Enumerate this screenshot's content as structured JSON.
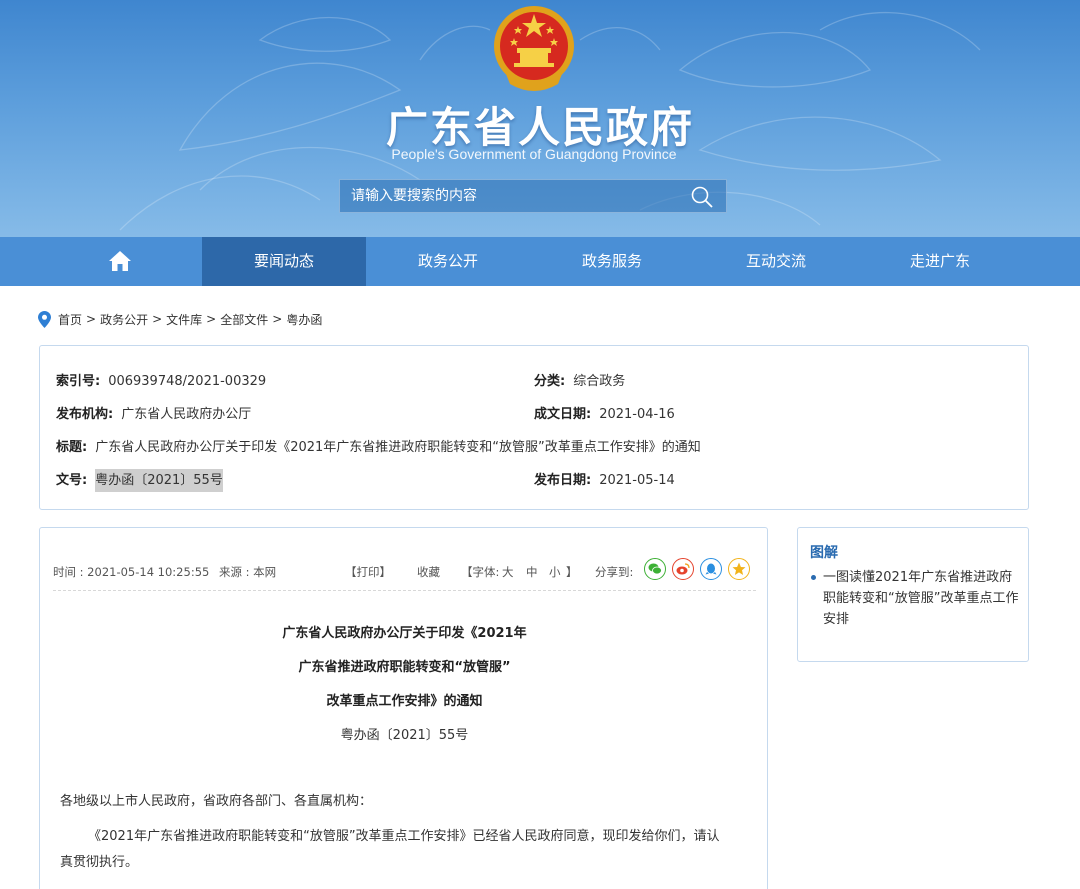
{
  "header": {
    "title": "广东省人民政府",
    "subtitle": "People's Government of Guangdong Province",
    "search_placeholder": "请输入要搜索的内容"
  },
  "nav": {
    "items": [
      "要闻动态",
      "政务公开",
      "政务服务",
      "互动交流",
      "走进广东"
    ],
    "active": "要闻动态"
  },
  "breadcrumb": [
    "首页",
    "政务公开",
    "文件库",
    "全部文件",
    "粤办函"
  ],
  "meta": {
    "index_label": "索引号:",
    "index_value": "006939748/2021-00329",
    "category_label": "分类:",
    "category_value": "综合政务",
    "publisher_label": "发布机构:",
    "publisher_value": "广东省人民政府办公厅",
    "created_label": "成文日期:",
    "created_value": "2021-04-16",
    "title_label": "标题:",
    "title_value": "广东省人民政府办公厅关于印发《2021年广东省推进政府职能转变和“放管服”改革重点工作安排》的通知",
    "docno_label": "文号:",
    "docno_value": "粤办函〔2021〕55号",
    "pubdate_label": "发布日期:",
    "pubdate_value": "2021-05-14"
  },
  "article": {
    "time": "时间 : 2021-05-14 10:25:55",
    "source": "来源 : 本网",
    "print": "【打印】",
    "favorite": "收藏",
    "font_label": "【字体:",
    "font_large": "大",
    "font_medium": "中",
    "font_small": "小",
    "font_end": "】",
    "share_label": "分享到:",
    "doc_title_lines": [
      "广东省人民政府办公厅关于印发《2021年",
      "广东省推进政府职能转变和“放管服”",
      "改革重点工作安排》的通知"
    ],
    "doc_number": "粤办函〔2021〕55号",
    "salutation": "各地级以上市人民政府，省政府各部门、各直属机构：",
    "body_line1": "《2021年广东省推进政府职能转变和“放管服”改革重点工作安排》已经省人民政府同意，现印发给你们，请认",
    "body_line2": "真贯彻执行。"
  },
  "side": {
    "heading": "图解",
    "link": "一图读懂2021年广东省推进政府职能转变和“放管服”改革重点工作安排"
  },
  "colors": {
    "nav_bg": "#4a8fd6",
    "nav_active": "#2d68a9",
    "box_border": "#c5d9ee",
    "wechat": "#3cb034",
    "weibo": "#e5432d",
    "qq": "#2b8fe0",
    "qzone": "#f2b31b"
  }
}
